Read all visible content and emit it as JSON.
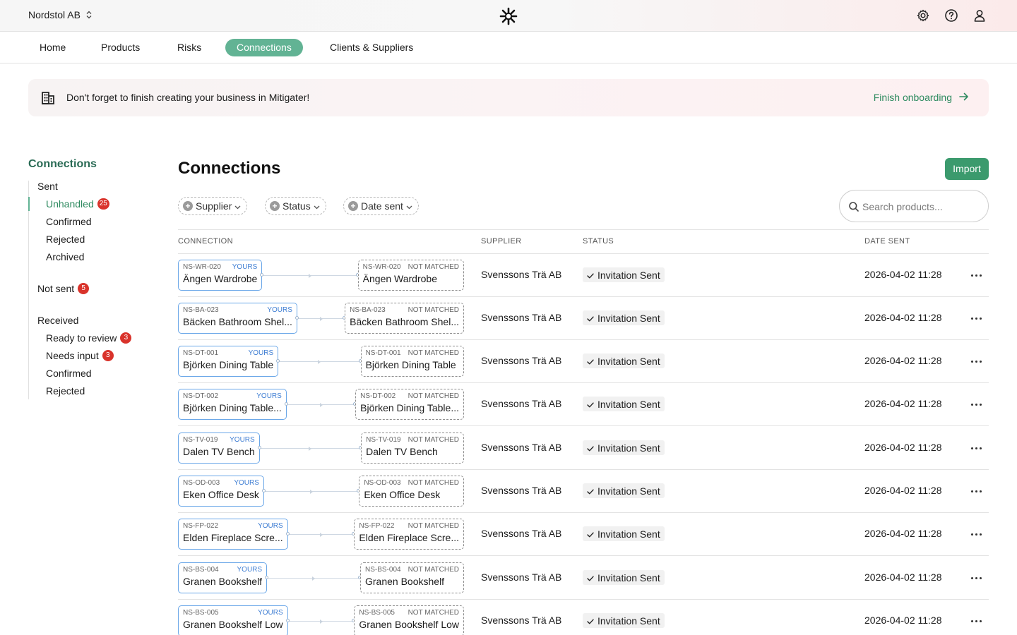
{
  "org": {
    "name": "Nordstol AB"
  },
  "nav": [
    {
      "label": "Home"
    },
    {
      "label": "Products"
    },
    {
      "label": "Risks"
    },
    {
      "label": "Connections",
      "active": true
    },
    {
      "label": "Clients & Suppliers"
    }
  ],
  "banner": {
    "text": "Don't forget to finish creating your business in Mitigater!",
    "link": "Finish onboarding"
  },
  "sidebar": {
    "title": "Connections",
    "sent_label": "Sent",
    "sent": [
      {
        "label": "Unhandled",
        "badge": "25",
        "active": true
      },
      {
        "label": "Confirmed"
      },
      {
        "label": "Rejected"
      },
      {
        "label": "Archived"
      }
    ],
    "not_sent": {
      "label": "Not sent",
      "badge": "5"
    },
    "received_label": "Received",
    "received": [
      {
        "label": "Ready to review",
        "badge": "3"
      },
      {
        "label": "Needs input",
        "badge": "3"
      },
      {
        "label": "Confirmed"
      },
      {
        "label": "Rejected"
      }
    ]
  },
  "main": {
    "title": "Connections",
    "import_label": "Import",
    "filters": [
      "Supplier",
      "Status",
      "Date sent"
    ],
    "search_placeholder": "Search products...",
    "columns": [
      "CONNECTION",
      "SUPPLIER",
      "STATUS",
      "DATE SENT"
    ],
    "yours_tag": "YOURS",
    "not_matched_tag": "NOT MATCHED",
    "rows": [
      {
        "code": "NS-WR-020",
        "name": "Ängen Wardrobe",
        "match_name": "Ängen Wardrobe",
        "supplier": "Svenssons Trä AB",
        "status": "Invitation Sent",
        "date": "2026-04-02 11:28"
      },
      {
        "code": "NS-BA-023",
        "name": "Bäcken Bathroom Shel...",
        "match_name": "Bäcken Bathroom Shel...",
        "supplier": "Svenssons Trä AB",
        "status": "Invitation Sent",
        "date": "2026-04-02 11:28"
      },
      {
        "code": "NS-DT-001",
        "name": "Björken Dining Table",
        "match_name": "Björken Dining Table",
        "supplier": "Svenssons Trä AB",
        "status": "Invitation Sent",
        "date": "2026-04-02 11:28"
      },
      {
        "code": "NS-DT-002",
        "name": "Björken Dining Table...",
        "match_name": "Björken Dining Table...",
        "supplier": "Svenssons Trä AB",
        "status": "Invitation Sent",
        "date": "2026-04-02 11:28"
      },
      {
        "code": "NS-TV-019",
        "name": "Dalen TV Bench",
        "match_name": "Dalen TV Bench",
        "supplier": "Svenssons Trä AB",
        "status": "Invitation Sent",
        "date": "2026-04-02 11:28"
      },
      {
        "code": "NS-OD-003",
        "name": "Eken Office Desk",
        "match_name": "Eken Office Desk",
        "supplier": "Svenssons Trä AB",
        "status": "Invitation Sent",
        "date": "2026-04-02 11:28"
      },
      {
        "code": "NS-FP-022",
        "name": "Elden Fireplace Scre...",
        "match_name": "Elden Fireplace Scre...",
        "supplier": "Svenssons Trä AB",
        "status": "Invitation Sent",
        "date": "2026-04-02 11:28"
      },
      {
        "code": "NS-BS-004",
        "name": "Granen Bookshelf",
        "match_name": "Granen Bookshelf",
        "supplier": "Svenssons Trä AB",
        "status": "Invitation Sent",
        "date": "2026-04-02 11:28"
      },
      {
        "code": "NS-BS-005",
        "name": "Granen Bookshelf Low",
        "match_name": "Granen Bookshelf Low",
        "supplier": "Svenssons Trä AB",
        "status": "Invitation Sent",
        "date": "2026-04-02 11:28"
      }
    ]
  },
  "colors": {
    "accent": "#62b394",
    "button": "#3b9a6d",
    "link": "#2e8a5f",
    "badge": "#d9332b",
    "yours_border": "#6aa7e8"
  },
  "icons": [
    "chevron-updown-icon",
    "logo-icon",
    "gear-icon",
    "help-icon",
    "user-icon",
    "building-icon",
    "arrow-right-icon",
    "plus-circle-icon",
    "chevron-down-icon",
    "search-icon",
    "check-icon",
    "more-icon"
  ]
}
